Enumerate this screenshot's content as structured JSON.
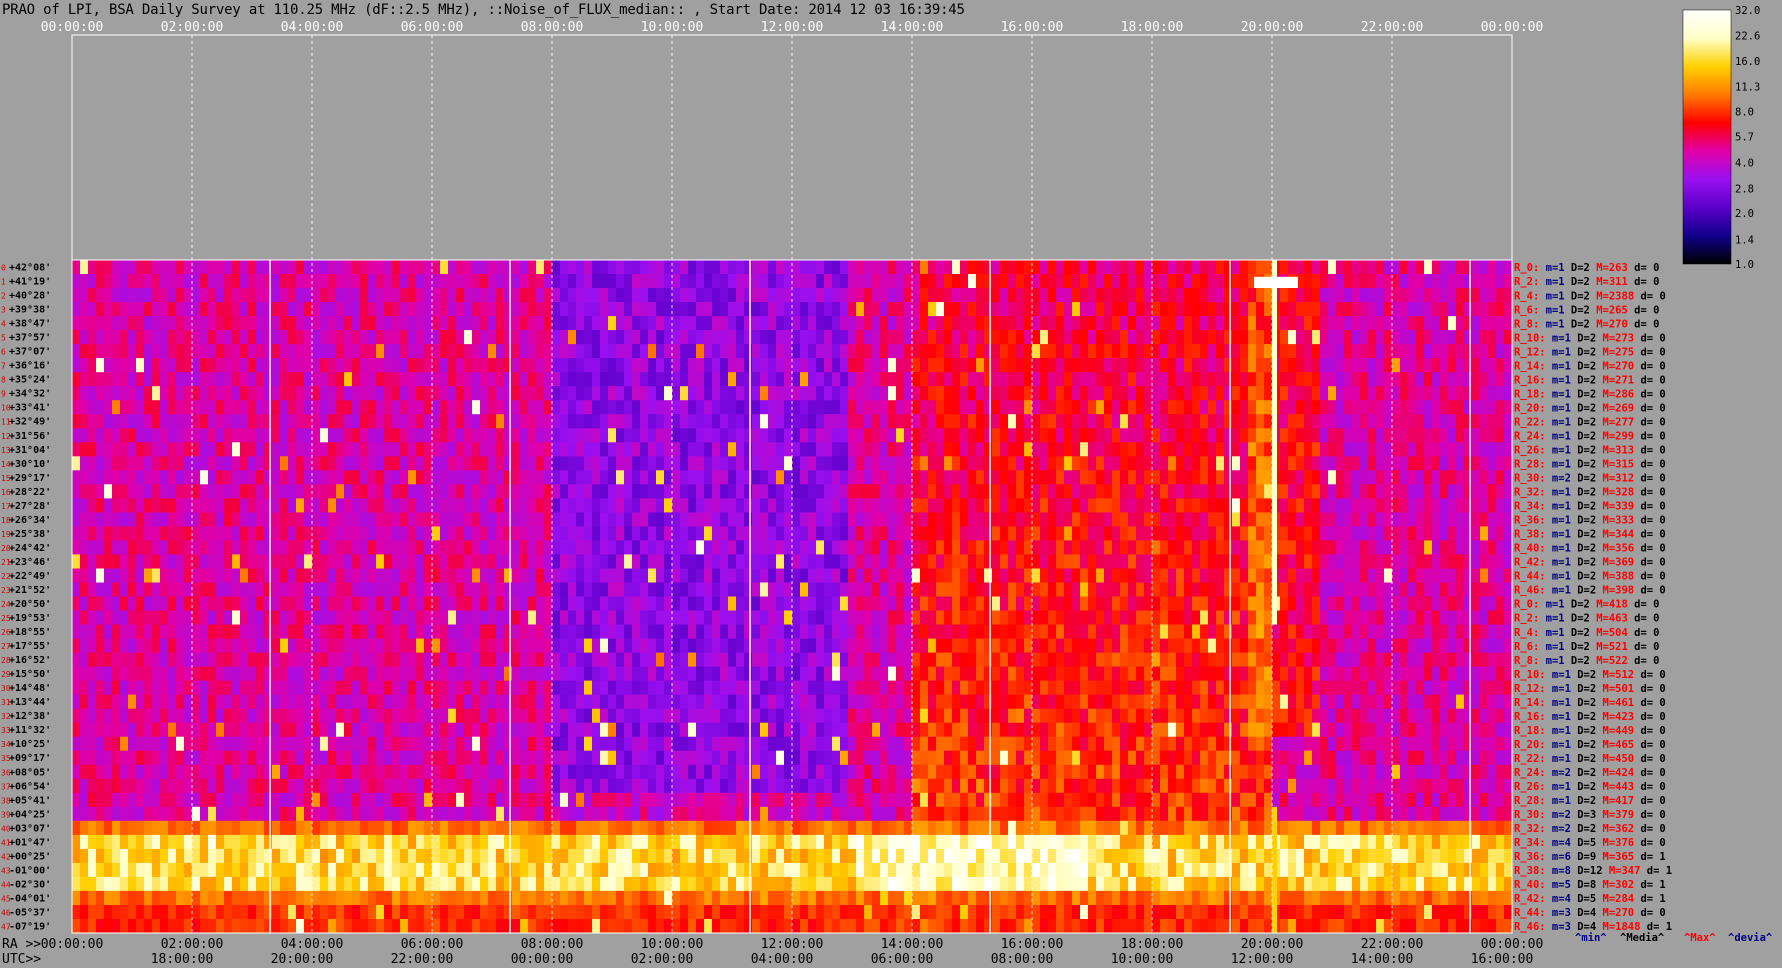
{
  "title": "PRAO of LPI, BSA Daily Survey at 110.25 MHz (dF::2.5 MHz), ::Noise_of_FLUX_median:: , Start Date: 2014 12 03 16:39:45",
  "chart_data": {
    "type": "heatmap",
    "title": "PRAO of LPI, BSA Daily Survey at 110.25 MHz (dF::2.5 MHz), ::Noise_of_FLUX_median:: , Start Date: 2014 12 03 16:39:45",
    "x_ra_top_ticks": [
      "00:00:00",
      "02:00:00",
      "04:00:00",
      "06:00:00",
      "08:00:00",
      "10:00:00",
      "12:00:00",
      "14:00:00",
      "16:00:00",
      "18:00:00",
      "20:00:00",
      "22:00:00",
      "00:00:00"
    ],
    "x_ra_bottom_ticks": [
      "00:00:00",
      "02:00:00",
      "04:00:00",
      "06:00:00",
      "08:00:00",
      "10:00:00",
      "12:00:00",
      "14:00:00",
      "16:00:00",
      "18:00:00",
      "20:00:00",
      "22:00:00",
      "00:00:00"
    ],
    "ra_range_hours": [
      0,
      24
    ],
    "utc_ticks": [
      "18:00:00",
      "20:00:00",
      "22:00:00",
      "00:00:00",
      "02:00:00",
      "04:00:00",
      "06:00:00",
      "08:00:00",
      "10:00:00",
      "12:00:00",
      "14:00:00",
      "16:00:00"
    ],
    "ra_axis_label": "RA >>",
    "utc_axis_label": "UTC>>",
    "declinations": [
      "+42°08'",
      "+41°19'",
      "+40°28'",
      "+39°38'",
      "+38°47'",
      "+37°57'",
      "+37°07'",
      "+36°16'",
      "+35°24'",
      "+34°32'",
      "+33°41'",
      "+32°49'",
      "+31°56'",
      "+31°04'",
      "+30°10'",
      "+29°17'",
      "+28°22'",
      "+27°28'",
      "+26°34'",
      "+25°38'",
      "+24°42'",
      "+23°46'",
      "+22°49'",
      "+21°52'",
      "+20°50'",
      "+19°53'",
      "+18°55'",
      "+17°55'",
      "+16°52'",
      "+15°50'",
      "+14°48'",
      "+13°44'",
      "+12°38'",
      "+11°32'",
      "+10°25'",
      "+09°17'",
      "+08°05'",
      "+06°54'",
      "+05°41'",
      "+04°25'",
      "+03°07'",
      "+01°47'",
      "+00°25'",
      "-01°00'",
      "-02°30'",
      "-04°01'",
      "-05°37'",
      "-07°19'"
    ],
    "beam_numbers": [
      "0",
      "1",
      "2",
      "3",
      "4",
      "5",
      "6",
      "7",
      "8",
      "9",
      "10",
      "11",
      "12",
      "13",
      "14",
      "15",
      "16",
      "17",
      "18",
      "19",
      "20",
      "21",
      "22",
      "23",
      "24",
      "25",
      "26",
      "27",
      "28",
      "29",
      "30",
      "31",
      "32",
      "33",
      "34",
      "35",
      "36",
      "37",
      "38",
      "39",
      "40",
      "41",
      "42",
      "43",
      "44",
      "45",
      "46",
      "47"
    ],
    "colorbar_ticks": [
      "32.0",
      "22.6",
      "16.0",
      "11.3",
      "8.0",
      "5.7",
      "4.0",
      "2.8",
      "2.0",
      "1.4",
      "1.0"
    ],
    "colorbar_range": [
      1.0,
      32.0
    ],
    "colorbar_scale": "log",
    "colormap": [
      "#000000",
      "#10008a",
      "#5a00c8",
      "#9a10f0",
      "#e000a8",
      "#ff0000",
      "#ff7a00",
      "#ffd000",
      "#ffffc8",
      "#ffffff"
    ],
    "row_stats": [
      {
        "name": "R_0:",
        "m": "m=1",
        "D": "D=2",
        "M": "M=263",
        "d": "d= 0"
      },
      {
        "name": "R_2:",
        "m": "m=1",
        "D": "D=2",
        "M": "M=311",
        "d": "d= 0"
      },
      {
        "name": "R_4:",
        "m": "m=1",
        "D": "D=2",
        "M": "M=2388",
        "d": "d= 0"
      },
      {
        "name": "R_6:",
        "m": "m=1",
        "D": "D=2",
        "M": "M=265",
        "d": "d= 0"
      },
      {
        "name": "R_8:",
        "m": "m=1",
        "D": "D=2",
        "M": "M=270",
        "d": "d= 0"
      },
      {
        "name": "R_10:",
        "m": "m=1",
        "D": "D=2",
        "M": "M=273",
        "d": "d= 0"
      },
      {
        "name": "R_12:",
        "m": "m=1",
        "D": "D=2",
        "M": "M=275",
        "d": "d= 0"
      },
      {
        "name": "R_14:",
        "m": "m=1",
        "D": "D=2",
        "M": "M=270",
        "d": "d= 0"
      },
      {
        "name": "R_16:",
        "m": "m=1",
        "D": "D=2",
        "M": "M=271",
        "d": "d= 0"
      },
      {
        "name": "R_18:",
        "m": "m=1",
        "D": "D=2",
        "M": "M=286",
        "d": "d= 0"
      },
      {
        "name": "R_20:",
        "m": "m=1",
        "D": "D=2",
        "M": "M=269",
        "d": "d= 0"
      },
      {
        "name": "R_22:",
        "m": "m=1",
        "D": "D=2",
        "M": "M=277",
        "d": "d= 0"
      },
      {
        "name": "R_24:",
        "m": "m=1",
        "D": "D=2",
        "M": "M=299",
        "d": "d= 0"
      },
      {
        "name": "R_26:",
        "m": "m=1",
        "D": "D=2",
        "M": "M=313",
        "d": "d= 0"
      },
      {
        "name": "R_28:",
        "m": "m=1",
        "D": "D=2",
        "M": "M=315",
        "d": "d= 0"
      },
      {
        "name": "R_30:",
        "m": "m=2",
        "D": "D=2",
        "M": "M=312",
        "d": "d= 0"
      },
      {
        "name": "R_32:",
        "m": "m=1",
        "D": "D=2",
        "M": "M=328",
        "d": "d= 0"
      },
      {
        "name": "R_34:",
        "m": "m=1",
        "D": "D=2",
        "M": "M=339",
        "d": "d= 0"
      },
      {
        "name": "R_36:",
        "m": "m=1",
        "D": "D=2",
        "M": "M=333",
        "d": "d= 0"
      },
      {
        "name": "R_38:",
        "m": "m=1",
        "D": "D=2",
        "M": "M=344",
        "d": "d= 0"
      },
      {
        "name": "R_40:",
        "m": "m=1",
        "D": "D=2",
        "M": "M=356",
        "d": "d= 0"
      },
      {
        "name": "R_42:",
        "m": "m=1",
        "D": "D=2",
        "M": "M=369",
        "d": "d= 0"
      },
      {
        "name": "R_44:",
        "m": "m=1",
        "D": "D=2",
        "M": "M=388",
        "d": "d= 0"
      },
      {
        "name": "R_46:",
        "m": "m=1",
        "D": "D=2",
        "M": "M=398",
        "d": "d= 0"
      },
      {
        "name": "R_0:",
        "m": "m=1",
        "D": "D=2",
        "M": "M=418",
        "d": "d= 0"
      },
      {
        "name": "R_2:",
        "m": "m=1",
        "D": "D=2",
        "M": "M=463",
        "d": "d= 0"
      },
      {
        "name": "R_4:",
        "m": "m=1",
        "D": "D=2",
        "M": "M=504",
        "d": "d= 0"
      },
      {
        "name": "R_6:",
        "m": "m=1",
        "D": "D=2",
        "M": "M=521",
        "d": "d= 0"
      },
      {
        "name": "R_8:",
        "m": "m=1",
        "D": "D=2",
        "M": "M=522",
        "d": "d= 0"
      },
      {
        "name": "R_10:",
        "m": "m=1",
        "D": "D=2",
        "M": "M=512",
        "d": "d= 0"
      },
      {
        "name": "R_12:",
        "m": "m=1",
        "D": "D=2",
        "M": "M=501",
        "d": "d= 0"
      },
      {
        "name": "R_14:",
        "m": "m=1",
        "D": "D=2",
        "M": "M=461",
        "d": "d= 0"
      },
      {
        "name": "R_16:",
        "m": "m=1",
        "D": "D=2",
        "M": "M=423",
        "d": "d= 0"
      },
      {
        "name": "R_18:",
        "m": "m=1",
        "D": "D=2",
        "M": "M=449",
        "d": "d= 0"
      },
      {
        "name": "R_20:",
        "m": "m=1",
        "D": "D=2",
        "M": "M=465",
        "d": "d= 0"
      },
      {
        "name": "R_22:",
        "m": "m=1",
        "D": "D=2",
        "M": "M=450",
        "d": "d= 0"
      },
      {
        "name": "R_24:",
        "m": "m=2",
        "D": "D=2",
        "M": "M=424",
        "d": "d= 0"
      },
      {
        "name": "R_26:",
        "m": "m=1",
        "D": "D=2",
        "M": "M=443",
        "d": "d= 0"
      },
      {
        "name": "R_28:",
        "m": "m=1",
        "D": "D=2",
        "M": "M=417",
        "d": "d= 0"
      },
      {
        "name": "R_30:",
        "m": "m=2",
        "D": "D=3",
        "M": "M=379",
        "d": "d= 0"
      },
      {
        "name": "R_32:",
        "m": "m=2",
        "D": "D=2",
        "M": "M=362",
        "d": "d= 0"
      },
      {
        "name": "R_34:",
        "m": "m=4",
        "D": "D=5",
        "M": "M=376",
        "d": "d= 0"
      },
      {
        "name": "R_36:",
        "m": "m=6",
        "D": "D=9",
        "M": "M=365",
        "d": "d= 1"
      },
      {
        "name": "R_38:",
        "m": "m=8",
        "D": "D=12",
        "M": "M=347",
        "d": "d= 1"
      },
      {
        "name": "R_40:",
        "m": "m=5",
        "D": "D=8",
        "M": "M=302",
        "d": "d= 1"
      },
      {
        "name": "R_42:",
        "m": "m=4",
        "D": "D=5",
        "M": "M=284",
        "d": "d= 1"
      },
      {
        "name": "R_44:",
        "m": "m=3",
        "D": "D=4",
        "M": "M=270",
        "d": "d= 0"
      },
      {
        "name": "R_46:",
        "m": "m=3",
        "D": "D=4",
        "M": "M=1848",
        "d": "d= 1"
      }
    ],
    "stats_legend": [
      "^min^",
      "^Media^",
      "^Max^",
      "^devia^"
    ],
    "stats_colors": {
      "min": "#000080",
      "media": "#000000",
      "max": "#ff0000",
      "devia": "#000080",
      "name": "#ff0000"
    },
    "legend": "none",
    "grid": true
  }
}
